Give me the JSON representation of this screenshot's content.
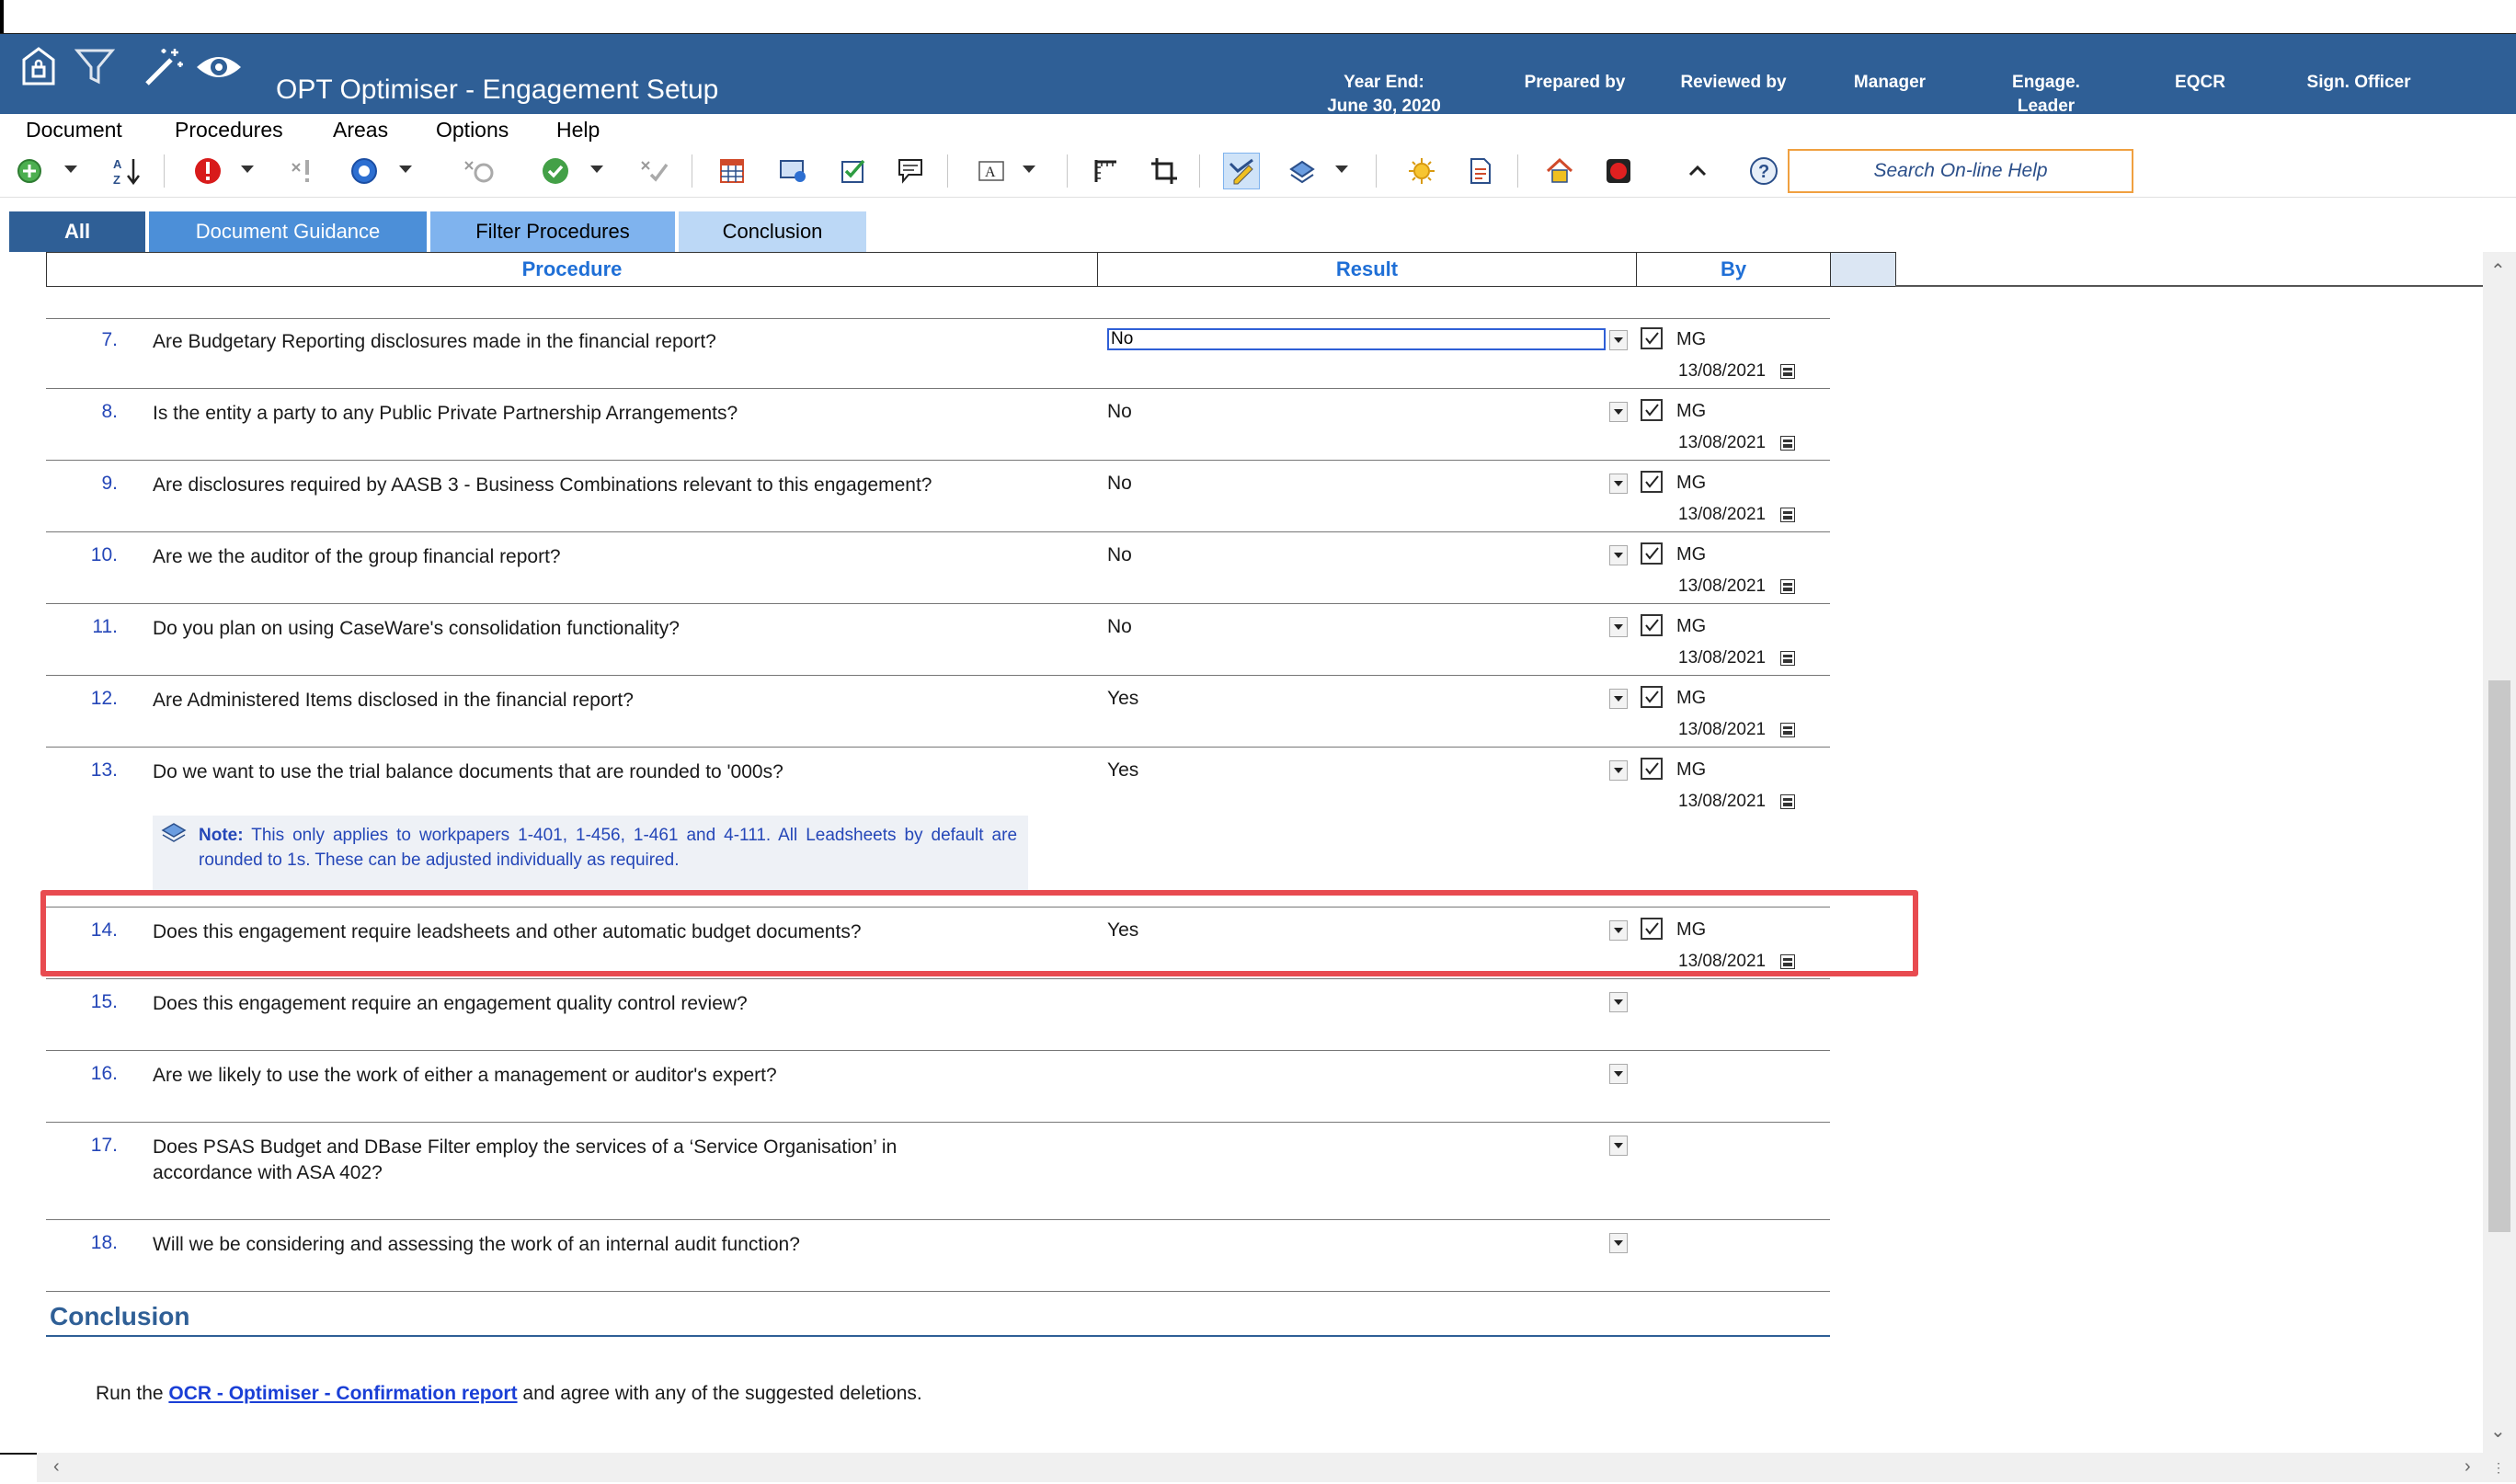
{
  "app": {
    "title": "OPT Optimiser - Engagement Setup",
    "header_columns": [
      {
        "line1": "Year End:",
        "line2": "June 30, 2020"
      },
      {
        "line1": "Prepared by",
        "line2": ""
      },
      {
        "line1": "Reviewed by",
        "line2": ""
      },
      {
        "line1": "Manager",
        "line2": ""
      },
      {
        "line1": "Engage.",
        "line2": "Leader"
      },
      {
        "line1": "EQCR",
        "line2": ""
      },
      {
        "line1": "Sign. Officer",
        "line2": ""
      }
    ]
  },
  "menu": [
    "Document",
    "Procedures",
    "Areas",
    "Options",
    "Help"
  ],
  "toolbar": {
    "search_placeholder": "Search On-line Help",
    "icons": [
      "add-circle-icon",
      "sort-az-icon",
      "exclamation-icon",
      "clear-exclamation-icon",
      "circle-icon",
      "clear-circle-icon",
      "check-circle-icon",
      "clear-check-icon",
      "table-icon",
      "screen-icon",
      "checklist-icon",
      "comment-icon",
      "font-icon",
      "ruler-icon",
      "crop-icon",
      "signoff-icon",
      "stamp-icon",
      "sun-icon",
      "document-icon",
      "home-icon",
      "stop-icon",
      "collapse-icon",
      "help-icon"
    ]
  },
  "tabs": {
    "all": "All",
    "guidance": "Document Guidance",
    "filter": "Filter Procedures",
    "conclusion": "Conclusion"
  },
  "columns": {
    "procedure": "Procedure",
    "result": "Result",
    "by": "By"
  },
  "rows": [
    {
      "num": "7.",
      "question": "Are Budgetary Reporting disclosures made in the financial report?",
      "result": "No",
      "initials": "MG",
      "date": "13/08/2021"
    },
    {
      "num": "8.",
      "question": "Is the entity a party to any Public Private Partnership Arrangements?",
      "result": "No",
      "initials": "MG",
      "date": "13/08/2021"
    },
    {
      "num": "9.",
      "question": "Are disclosures required by AASB 3 - Business Combinations relevant to this engagement?",
      "result": "No",
      "initials": "MG",
      "date": "13/08/2021"
    },
    {
      "num": "10.",
      "question": "Are we the auditor of the group financial report?",
      "result": "No",
      "initials": "MG",
      "date": "13/08/2021"
    },
    {
      "num": "11.",
      "question": "Do you plan on using CaseWare's consolidation functionality?",
      "result": "No",
      "initials": "MG",
      "date": "13/08/2021"
    },
    {
      "num": "12.",
      "question": "Are Administered Items disclosed in the financial report?",
      "result": "Yes",
      "initials": "MG",
      "date": "13/08/2021"
    },
    {
      "num": "13.",
      "question": "Do we want to use the trial balance documents that are rounded to '000s?",
      "result": "Yes",
      "initials": "MG",
      "date": "13/08/2021"
    },
    {
      "num": "14.",
      "question": "Does this engagement require leadsheets and other automatic budget documents?",
      "result": "Yes",
      "initials": "MG",
      "date": "13/08/2021"
    },
    {
      "num": "15.",
      "question": "Does this engagement require an engagement quality control review?",
      "result": "",
      "initials": "",
      "date": ""
    },
    {
      "num": "16.",
      "question": "Are we likely to use the work of either a management or auditor's expert?",
      "result": "",
      "initials": "",
      "date": ""
    },
    {
      "num": "17.",
      "question": "Does PSAS Budget and DBase Filter employ the services of a ‘Service Organisation’ in accordance with ASA 402?",
      "result": "",
      "initials": "",
      "date": ""
    },
    {
      "num": "18.",
      "question": "Will we be considering and assessing the work of an internal audit function?",
      "result": "",
      "initials": "",
      "date": ""
    }
  ],
  "note": {
    "label": "Note:",
    "text": "This only applies to workpapers 1-401, 1-456, 1-461 and 4-111. All Leadsheets by default are rounded to 1s. These can be adjusted individually as required."
  },
  "conclusion": {
    "title": "Conclusion",
    "prefix": "Run the ",
    "link": "OCR - Optimiser - Confirmation report",
    "suffix": " and agree with any of the suggested deletions."
  },
  "colors": {
    "titlebar": "#2f5f96",
    "highlight": "#e84b50",
    "link": "#1a3fd6",
    "number": "#2547b8"
  }
}
